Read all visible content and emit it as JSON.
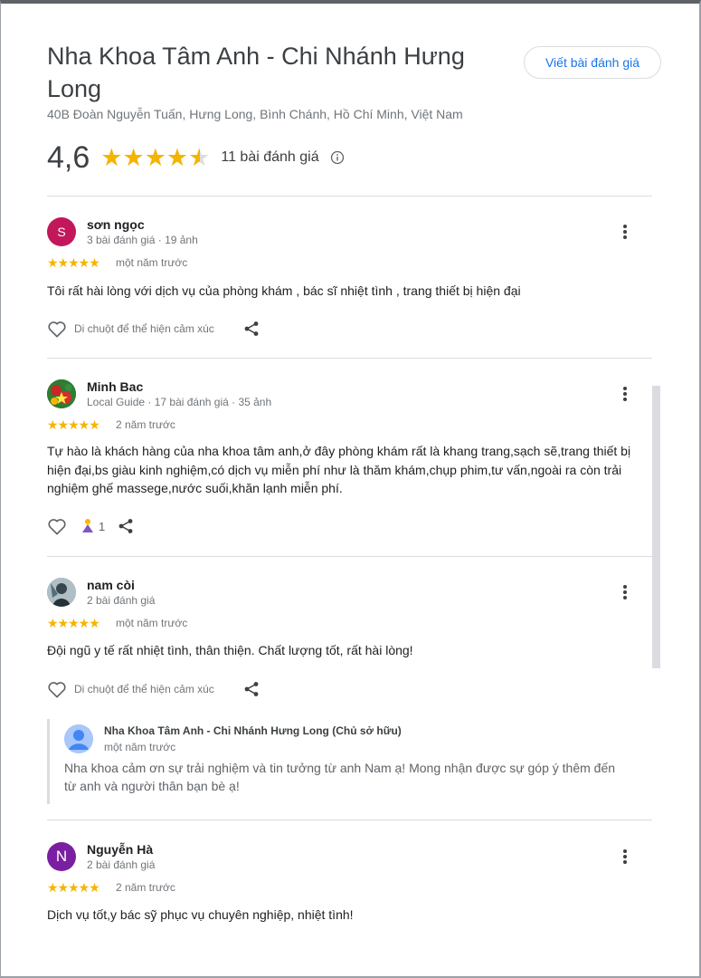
{
  "place": {
    "title": "Nha Khoa Tâm Anh - Chi Nhánh Hưng Long",
    "address": "40B Đoàn Nguyễn Tuấn, Hưng Long, Bình Chánh, Hồ Chí Minh, Việt Nam",
    "rating": "4,6",
    "rating_value": 4.6,
    "review_count_label": "11 bài đánh giá",
    "write_review_label": "Viết bài đánh giá"
  },
  "colors": {
    "star": "#f5b400",
    "link": "#1a73e8",
    "avatar_s": "#c2185b",
    "avatar_n": "#7b1fa2"
  },
  "reviews": [
    {
      "avatar_letter": "S",
      "name": "sơn ngọc",
      "meta": "3 bài đánh giá · 19 ảnh",
      "stars": "★★★★★",
      "when": "một năm trước",
      "text": "Tôi rất hài lòng với dịch vụ của phòng khám , bác sĩ nhiệt tình , trang thiết bị hiện đại",
      "reaction_hint": "Di chuột để thể hiện cảm xúc"
    },
    {
      "avatar_letter": "",
      "name": "Minh Bac",
      "meta": "Local Guide · 17 bài đánh giá · 35 ảnh",
      "stars": "★★★★★",
      "when": "2 năm trước",
      "text": "Tự hào là khách hàng của nha khoa tâm anh,ở đây phòng khám rất là khang trang,sạch sẽ,trang thiết bị hiện đại,bs giàu kinh nghiệm,có dịch vụ miễn phí như là thăm khám,chụp phim,tư vấn,ngoài ra còn trải nghiệm ghế massege,nước suối,khăn lạnh miễn phí.",
      "reaction_count": "1"
    },
    {
      "avatar_letter": "",
      "name": "nam còi",
      "meta": "2 bài đánh giá",
      "stars": "★★★★★",
      "when": "một năm trước",
      "text": "Đội ngũ y tế rất nhiệt tình, thân thiện. Chất lượng tốt, rất hài lòng!",
      "reaction_hint": "Di chuột để thể hiện cảm xúc",
      "owner_reply": {
        "name": "Nha Khoa Tâm Anh - Chi Nhánh Hưng Long (Chủ sở hữu)",
        "when": "một năm trước",
        "text": "Nha khoa cảm ơn sự trải nghiệm và tin tưởng từ anh Nam ạ! Mong nhận được sự góp ý thêm đến từ anh và người thân bạn bè ạ!"
      }
    },
    {
      "avatar_letter": "N",
      "name": "Nguyễn Hà",
      "meta": "2 bài đánh giá",
      "stars": "★★★★★",
      "when": "2 năm trước",
      "text": "Dịch vụ tốt,y bác sỹ phục vụ chuyên nghiệp, nhiệt tình!"
    }
  ]
}
